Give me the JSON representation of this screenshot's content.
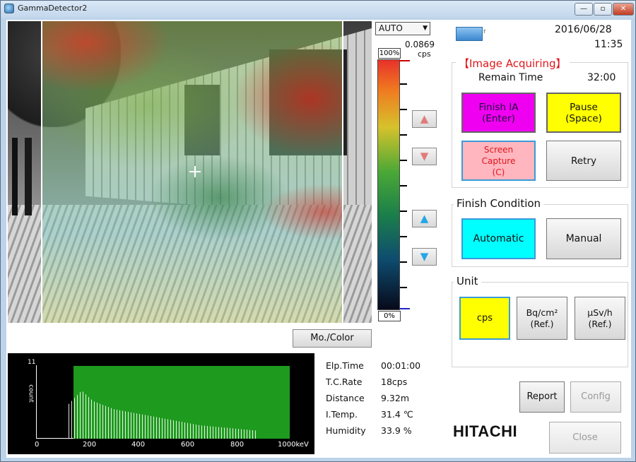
{
  "window": {
    "title": "GammaDetector2",
    "minimize_glyph": "—",
    "maximize_glyph": "▫",
    "close_glyph": "✕"
  },
  "scale": {
    "mode": "AUTO",
    "max_value": "0.0869",
    "max_unit": "cps",
    "max_pct": "100%",
    "min_pct": "0%",
    "up_glyph": "▲",
    "down_glyph": "▼"
  },
  "mono_color_button": "Mo./Color",
  "spectrum": {
    "y_max": "11",
    "y_label": "count",
    "x_ticks": [
      "0",
      "200",
      "400",
      "600",
      "800",
      "1000keV"
    ]
  },
  "readings": [
    {
      "label": "Elp.Time",
      "value": "00:01:00"
    },
    {
      "label": "T.C.Rate",
      "value": "18cps"
    },
    {
      "label": "Distance",
      "value": "9.32m"
    },
    {
      "label": "I.Temp.",
      "value": "31.4 ℃"
    },
    {
      "label": "Humidity",
      "value": "33.9 %"
    }
  ],
  "header": {
    "date": "2016/06/28",
    "time": "11:35",
    "indicator_text": "r"
  },
  "image_acquiring": {
    "title": "【Image Acquiring】",
    "remain_label": "Remain Time",
    "remain_value": "32:00",
    "finish_line1": "Finish IA",
    "finish_line2": "(Enter)",
    "pause_line1": "Pause",
    "pause_line2": "(Space)",
    "capture_line1": "Screen",
    "capture_line2": "Capture",
    "capture_line3": "(C)",
    "retry": "Retry"
  },
  "finish_condition": {
    "title": "Finish Condition",
    "automatic": "Automatic",
    "manual": "Manual"
  },
  "unit": {
    "title": "Unit",
    "cps": "cps",
    "bq_line1": "Bq/cm²",
    "bq_line2": "(Ref.)",
    "usv_line1": "μSv/h",
    "usv_line2": "(Ref.)"
  },
  "footer": {
    "report": "Report",
    "config": "Config",
    "close": "Close",
    "brand": "HITACHI"
  },
  "colors": {
    "finish_button": "#f000f0",
    "pause_button": "#ffff00",
    "capture_button": "#ffb6bf",
    "automatic_button": "#00ffff",
    "cps_button": "#ffff00",
    "ia_title": "#e0161b"
  }
}
